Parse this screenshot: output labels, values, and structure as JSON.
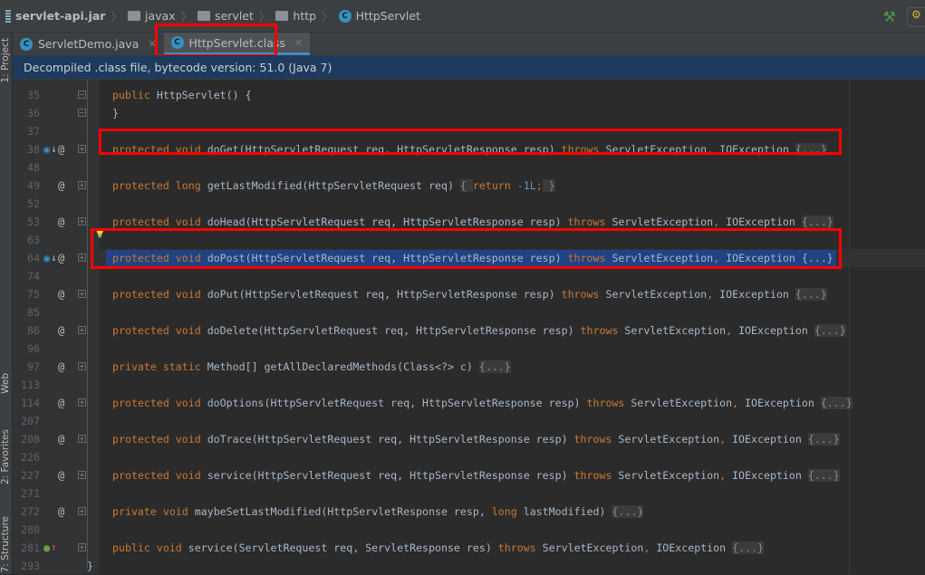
{
  "breadcrumb": [
    {
      "label": "servlet-api.jar",
      "icon": "jar-icon"
    },
    {
      "label": "javax",
      "icon": "folder-icon"
    },
    {
      "label": "servlet",
      "icon": "folder-icon"
    },
    {
      "label": "http",
      "icon": "folder-icon"
    },
    {
      "label": "HttpServlet",
      "icon": "class-icon"
    }
  ],
  "tool_strip": {
    "project": "1: Project",
    "web": "Web",
    "favorites": "2: Favorites",
    "structure": "7: Structure"
  },
  "tabs": [
    {
      "label": "ServletDemo.java",
      "active": false
    },
    {
      "label": "HttpServlet.class",
      "active": true
    }
  ],
  "banner": "Decompiled .class file, bytecode version: 51.0 (Java 7)",
  "colors": {
    "keyword": "#cc7832",
    "text": "#a9b7c6",
    "selection": "#214283",
    "highlight_box": "#ff0000"
  },
  "lines": [
    {
      "n": "35",
      "fold": "-",
      "t": [
        [
          "kw",
          "public "
        ],
        [
          "p",
          "HttpServlet() {"
        ]
      ]
    },
    {
      "n": "36",
      "fold": "-",
      "t": [
        [
          "p",
          "}"
        ]
      ]
    },
    {
      "n": "37",
      "t": []
    },
    {
      "n": "38",
      "icons": "impl-override",
      "fold": "+",
      "box": true,
      "t": [
        [
          "kw",
          "protected void "
        ],
        [
          "p",
          "doGet(HttpServletRequest req, HttpServletResponse resp) "
        ],
        [
          "kw",
          "throws "
        ],
        [
          "p",
          "ServletException"
        ],
        [
          "kw",
          ", "
        ],
        [
          "p",
          "IOException "
        ],
        [
          "fd",
          "{...}"
        ]
      ]
    },
    {
      "n": "48",
      "t": []
    },
    {
      "n": "49",
      "icons": "override",
      "fold": "+",
      "t": [
        [
          "kw",
          "protected long "
        ],
        [
          "p",
          "getLastModified(HttpServletRequest req) "
        ],
        [
          "fd",
          "{ "
        ],
        [
          "kw",
          "return "
        ],
        [
          "num",
          "-1L"
        ],
        [
          "kw",
          ";"
        ],
        [
          "fd",
          " }"
        ]
      ]
    },
    {
      "n": "52",
      "t": []
    },
    {
      "n": "53",
      "icons": "override",
      "fold": "+",
      "t": [
        [
          "kw",
          "protected void "
        ],
        [
          "p",
          "doHead(HttpServletRequest req, HttpServletResponse resp) "
        ],
        [
          "kw",
          "throws "
        ],
        [
          "p",
          "ServletException"
        ],
        [
          "kw",
          ", "
        ],
        [
          "p",
          "IOException "
        ],
        [
          "fd",
          "{...}"
        ]
      ]
    },
    {
      "n": "63",
      "bulb": true,
      "t": []
    },
    {
      "n": "64",
      "icons": "impl-override",
      "fold": "+",
      "selected": true,
      "box": true,
      "t": [
        [
          "kw",
          "protected void "
        ],
        [
          "p",
          "doPost(HttpServletRequest req, HttpServletResponse resp) "
        ],
        [
          "kw",
          "throws "
        ],
        [
          "p",
          "ServletException"
        ],
        [
          "kw",
          ", "
        ],
        [
          "p",
          "IOException "
        ],
        [
          "p",
          "{...}"
        ]
      ]
    },
    {
      "n": "74",
      "t": []
    },
    {
      "n": "75",
      "icons": "override",
      "fold": "+",
      "t": [
        [
          "kw",
          "protected void "
        ],
        [
          "p",
          "doPut(HttpServletRequest req, HttpServletResponse resp) "
        ],
        [
          "kw",
          "throws "
        ],
        [
          "p",
          "ServletException"
        ],
        [
          "kw",
          ", "
        ],
        [
          "p",
          "IOException "
        ],
        [
          "fd",
          "{...}"
        ]
      ]
    },
    {
      "n": "85",
      "t": []
    },
    {
      "n": "86",
      "icons": "override",
      "fold": "+",
      "t": [
        [
          "kw",
          "protected void "
        ],
        [
          "p",
          "doDelete(HttpServletRequest req, HttpServletResponse resp) "
        ],
        [
          "kw",
          "throws "
        ],
        [
          "p",
          "ServletException"
        ],
        [
          "kw",
          ", "
        ],
        [
          "p",
          "IOException "
        ],
        [
          "fd",
          "{...}"
        ]
      ]
    },
    {
      "n": "96",
      "t": []
    },
    {
      "n": "97",
      "icons": "override",
      "fold": "+",
      "t": [
        [
          "kw",
          "private static "
        ],
        [
          "p",
          "Method[] getAllDeclaredMethods(Class<?> c) "
        ],
        [
          "fd",
          "{...}"
        ]
      ]
    },
    {
      "n": "113",
      "t": []
    },
    {
      "n": "114",
      "icons": "override",
      "fold": "+",
      "t": [
        [
          "kw",
          "protected void "
        ],
        [
          "p",
          "doOptions(HttpServletRequest req, HttpServletResponse resp) "
        ],
        [
          "kw",
          "throws "
        ],
        [
          "p",
          "ServletException"
        ],
        [
          "kw",
          ", "
        ],
        [
          "p",
          "IOException "
        ],
        [
          "fd",
          "{...}"
        ]
      ]
    },
    {
      "n": "207",
      "t": []
    },
    {
      "n": "208",
      "icons": "override",
      "fold": "+",
      "t": [
        [
          "kw",
          "protected void "
        ],
        [
          "p",
          "doTrace(HttpServletRequest req, HttpServletResponse resp) "
        ],
        [
          "kw",
          "throws "
        ],
        [
          "p",
          "ServletException"
        ],
        [
          "kw",
          ", "
        ],
        [
          "p",
          "IOException "
        ],
        [
          "fd",
          "{...}"
        ]
      ]
    },
    {
      "n": "226",
      "t": []
    },
    {
      "n": "227",
      "icons": "override",
      "fold": "+",
      "t": [
        [
          "kw",
          "protected void "
        ],
        [
          "p",
          "service(HttpServletRequest req, HttpServletResponse resp) "
        ],
        [
          "kw",
          "throws "
        ],
        [
          "p",
          "ServletException"
        ],
        [
          "kw",
          ", "
        ],
        [
          "p",
          "IOException "
        ],
        [
          "fd",
          "{...}"
        ]
      ]
    },
    {
      "n": "271",
      "t": []
    },
    {
      "n": "272",
      "icons": "override",
      "fold": "+",
      "t": [
        [
          "kw",
          "private void "
        ],
        [
          "p",
          "maybeSetLastModified(HttpServletResponse resp, "
        ],
        [
          "kw",
          "long "
        ],
        [
          "p",
          "lastModified) "
        ],
        [
          "fd",
          "{...}"
        ]
      ]
    },
    {
      "n": "280",
      "t": []
    },
    {
      "n": "281",
      "icons": "implements",
      "fold": "+",
      "t": [
        [
          "kw",
          "public void "
        ],
        [
          "p",
          "service(ServletRequest req, ServletResponse res) "
        ],
        [
          "kw",
          "throws "
        ],
        [
          "p",
          "ServletException"
        ],
        [
          "kw",
          ", "
        ],
        [
          "p",
          "IOException "
        ],
        [
          "fd",
          "{...}"
        ]
      ]
    },
    {
      "n": "293",
      "t": [
        [
          "p",
          "}"
        ]
      ],
      "outdent": true
    }
  ]
}
